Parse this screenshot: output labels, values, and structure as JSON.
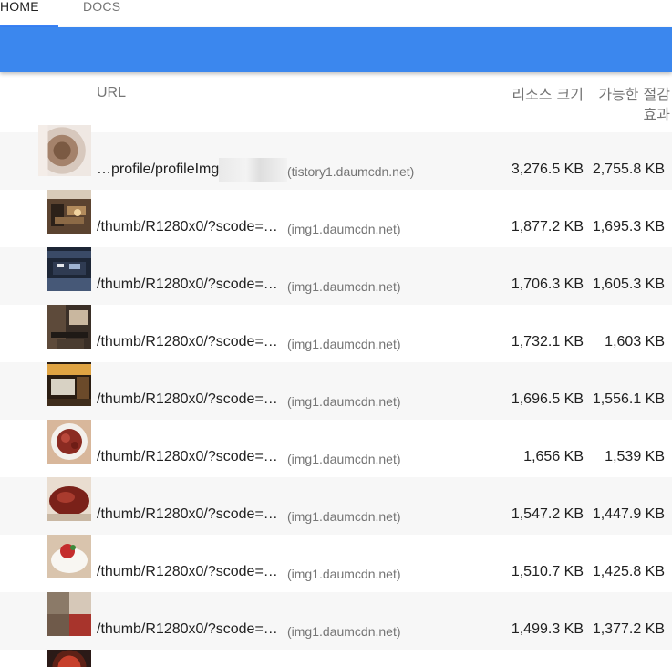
{
  "tabs": [
    {
      "label": "HOME",
      "active": true
    },
    {
      "label": "DOCS",
      "active": false
    }
  ],
  "colors": {
    "accent": "#3b87ee",
    "shaded_row": "#f7f7f7"
  },
  "table": {
    "headers": {
      "url": "URL",
      "resource_size": "리소스 크기",
      "potential_savings": "가능한 절감 효과"
    },
    "rows": [
      {
        "thumb_icon": "blurred-profile-image",
        "url": "…profile/profileImg",
        "host": "(tistory1.daumcdn.net)",
        "size": "3,276.5 KB",
        "savings": "2,755.8 KB"
      },
      {
        "thumb_icon": "restaurant-interior-image",
        "url": "/thumb/R1280x0/?scode=…",
        "host": "(img1.daumcdn.net)",
        "size": "1,877.2 KB",
        "savings": "1,695.3 KB"
      },
      {
        "thumb_icon": "storefront-image",
        "url": "/thumb/R1280x0/?scode=…",
        "host": "(img1.daumcdn.net)",
        "size": "1,706.3 KB",
        "savings": "1,605.3 KB"
      },
      {
        "thumb_icon": "dining-room-image",
        "url": "/thumb/R1280x0/?scode=…",
        "host": "(img1.daumcdn.net)",
        "size": "1,732.1 KB",
        "savings": "1,603 KB"
      },
      {
        "thumb_icon": "menu-board-image",
        "url": "/thumb/R1280x0/?scode=…",
        "host": "(img1.daumcdn.net)",
        "size": "1,696.5 KB",
        "savings": "1,556.1 KB"
      },
      {
        "thumb_icon": "meat-dish-image",
        "url": "/thumb/R1280x0/?scode=…",
        "host": "(img1.daumcdn.net)",
        "size": "1,656 KB",
        "savings": "1,539 KB"
      },
      {
        "thumb_icon": "meat-platter-image",
        "url": "/thumb/R1280x0/?scode=…",
        "host": "(img1.daumcdn.net)",
        "size": "1,547.2 KB",
        "savings": "1,447.9 KB"
      },
      {
        "thumb_icon": "noodle-bowl-image",
        "url": "/thumb/R1280x0/?scode=…",
        "host": "(img1.daumcdn.net)",
        "size": "1,510.7 KB",
        "savings": "1,425.8 KB"
      },
      {
        "thumb_icon": "collage-image",
        "url": "/thumb/R1280x0/?scode=…",
        "host": "(img1.daumcdn.net)",
        "size": "1,499.3 KB",
        "savings": "1,377.2 KB"
      }
    ]
  }
}
